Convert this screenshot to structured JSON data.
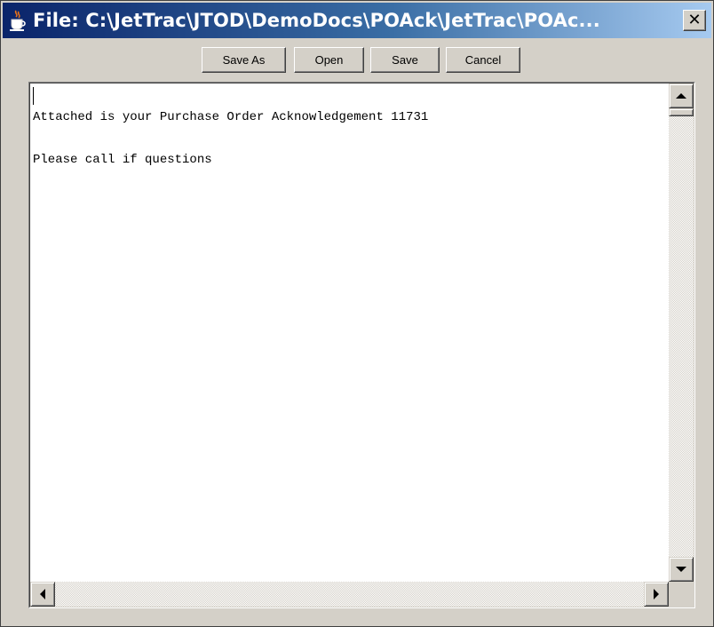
{
  "window": {
    "title": "File: C:\\JetTrac\\JTOD\\DemoDocs\\POAck\\JetTrac\\POAc...",
    "close_glyph": "✕",
    "app_icon": "java-coffee-cup-icon"
  },
  "toolbar": {
    "save_as_label": "Save As",
    "open_label": "Open",
    "save_label": "Save",
    "cancel_label": "Cancel"
  },
  "document": {
    "lines": [
      "",
      "Attached is your Purchase Order Acknowledgement 11731",
      "",
      "Please call if questions"
    ]
  },
  "colors": {
    "title_gradient_start": "#0a246a",
    "title_gradient_end": "#a6caf0",
    "window_face": "#d4d0c8"
  }
}
